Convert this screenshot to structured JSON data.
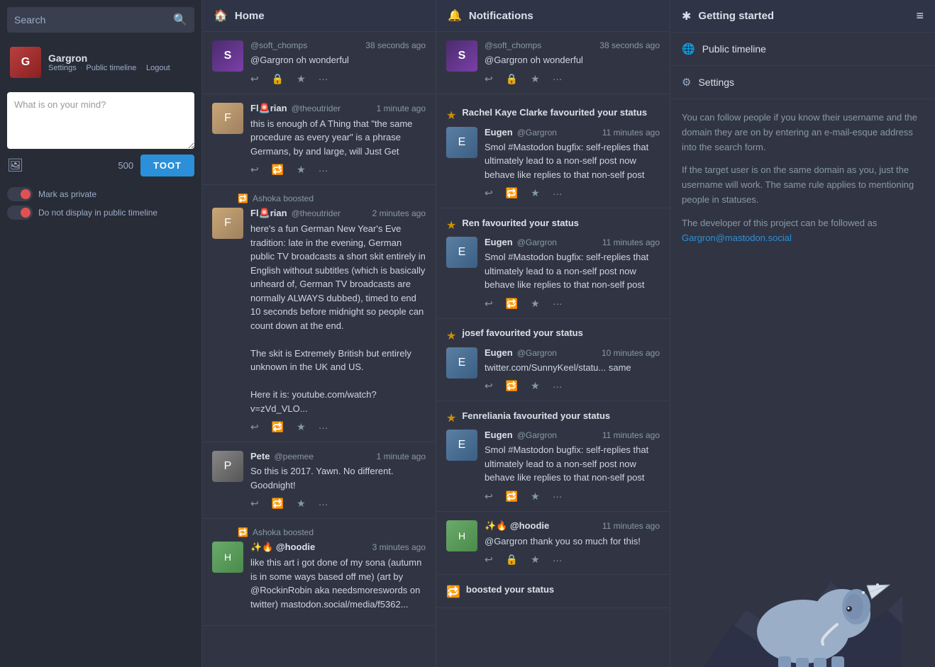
{
  "sidebar": {
    "search_placeholder": "Search",
    "profile": {
      "name": "Gargron",
      "links": [
        "Settings",
        "Public timeline",
        "Logout"
      ]
    },
    "compose": {
      "placeholder": "What is on your mind?",
      "char_count": "500",
      "toot_label": "TOOT"
    },
    "privacy": {
      "mark_private": "Mark as private",
      "no_public": "Do not display in public timeline"
    }
  },
  "home": {
    "title": "Home",
    "icon": "🏠",
    "statuses": [
      {
        "id": "s1",
        "handle": "@soft_chomps",
        "time": "38 seconds ago",
        "body": "@Gargron oh wonderful",
        "avatar_type": "soft-chomps"
      },
      {
        "id": "s2",
        "name": "Fl🚨rian",
        "handle": "@theoutrider",
        "time": "1 minute ago",
        "body": "this is enough of A Thing that \"the same procedure as every year\" is a phrase Germans, by and large, will Just Get",
        "avatar_type": "florian"
      },
      {
        "id": "s3",
        "boost_by": "Ashoka boosted",
        "name": "Fl🚨rian",
        "handle": "@theoutrider",
        "time": "2 minutes ago",
        "body": "here's a fun German New Year's Eve tradition: late in the evening, German public TV broadcasts a short skit entirely in English without subtitles (which is basically unheard of, German TV broadcasts are normally ALWAYS dubbed), timed to end 10 seconds before midnight so people can count down at the end.\n\nThe skit is Extremely British but entirely unknown in the UK and US.\n\nHere it is: youtube.com/watch?v=zVd_VLO...",
        "avatar_type": "florian"
      },
      {
        "id": "s4",
        "name": "Pete",
        "handle": "@peemee",
        "time": "1 minute ago",
        "body": "So this is 2017. Yawn. No different. Goodnight!",
        "avatar_type": "pete"
      },
      {
        "id": "s5",
        "boost_by": "Ashoka boosted",
        "name": "✨🔥 @hoodie",
        "handle": "",
        "time": "3 minutes ago",
        "body": "like this art i got done of my sona (autumn is in some ways based off me) (art by @RockinRobin aka needsmoreswords on twitter) mastodon.social/media/f5362...",
        "avatar_type": "hoodie"
      }
    ]
  },
  "notifications": {
    "title": "Notifications",
    "icon": "🔔",
    "items": [
      {
        "id": "n0",
        "type": "status",
        "handle": "@soft_chomps",
        "time": "38 seconds ago",
        "body": "@Gargron oh wonderful",
        "avatar_type": "soft-chomps"
      },
      {
        "id": "n1",
        "type": "fav",
        "event": "Rachel Kaye Clarke favourited your status",
        "reply_name": "Eugen",
        "reply_handle": "@Gargron",
        "reply_time": "11 minutes ago",
        "reply_body": "Smol #Mastodon bugfix: self-replies that ultimately lead to a non-self post now behave like replies to that non-self post",
        "avatar_type": "eugen"
      },
      {
        "id": "n2",
        "type": "fav",
        "event": "Ren favourited your status",
        "reply_name": "Eugen",
        "reply_handle": "@Gargron",
        "reply_time": "11 minutes ago",
        "reply_body": "Smol #Mastodon bugfix: self-replies that ultimately lead to a non-self post now behave like replies to that non-self post",
        "avatar_type": "eugen"
      },
      {
        "id": "n3",
        "type": "fav",
        "event": "josef favourited your status",
        "reply_name": "Eugen",
        "reply_handle": "@Gargron",
        "reply_time": "10 minutes ago",
        "reply_body": "twitter.com/SunnyKeel/statu... same",
        "avatar_type": "eugen"
      },
      {
        "id": "n4",
        "type": "fav",
        "event": "Fenreliania favourited your status",
        "reply_name": "Eugen",
        "reply_handle": "@Gargron",
        "reply_time": "11 minutes ago",
        "reply_body": "Smol #Mastodon bugfix: self-replies that ultimately lead to a non-self post now behave like replies to that non-self post",
        "avatar_type": "eugen"
      },
      {
        "id": "n5",
        "type": "status",
        "handle": "✨🔥 @hoodie",
        "time": "11 minutes ago",
        "body": "@Gargron thank you so much for this!",
        "avatar_type": "hoodie"
      },
      {
        "id": "n6",
        "type": "boost",
        "event": "boosted your status"
      }
    ]
  },
  "getting_started": {
    "title": "Getting started",
    "icon": "✱",
    "menu_icon": "≡",
    "nav": [
      {
        "icon": "🌐",
        "label": "Public timeline"
      },
      {
        "icon": "⚙",
        "label": "Settings"
      }
    ],
    "info": [
      "You can follow people if you know their username and the domain they are on by entering an e-mail-esque address into the search form.",
      "If the target user is on the same domain as you, just the username will work. The same rule applies to mentioning people in statuses.",
      "The developer of this project can be followed as Gargron@mastodon.social"
    ]
  }
}
